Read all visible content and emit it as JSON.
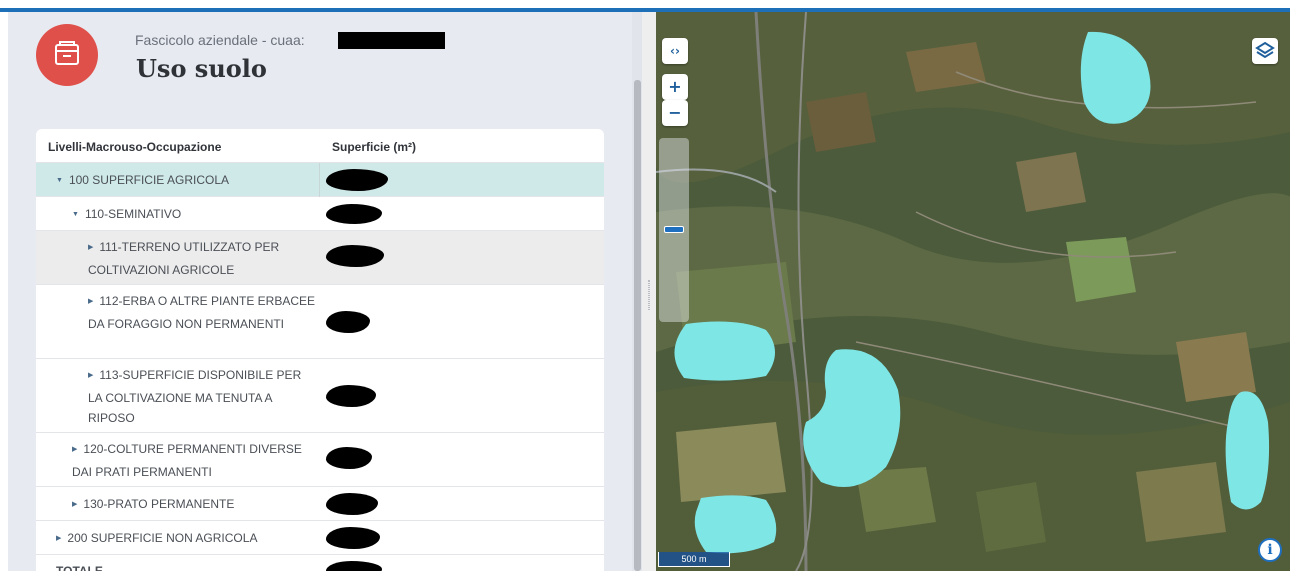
{
  "header": {
    "subtitle": "Fascicolo aziendale - cuaa:",
    "title": "Uso suolo"
  },
  "table": {
    "col_label": "Livelli-Macrouso-Occupazione",
    "col_area": "Superficie (m²)",
    "rows": [
      {
        "label": "100 SUPERFICIE AGRICOLA",
        "expanded": true
      },
      {
        "label": "110-SEMINATIVO",
        "expanded": true
      },
      {
        "label": "111-TERRENO UTILIZZATO PER COLTIVAZIONI AGRICOLE",
        "expanded": false
      },
      {
        "label": "112-ERBA O ALTRE PIANTE ERBACEE DA FORAGGIO NON PERMANENTI",
        "expanded": false
      },
      {
        "label": "113-SUPERFICIE DISPONIBILE PER LA COLTIVAZIONE MA TENUTA A RIPOSO",
        "expanded": false
      },
      {
        "label": "120-COLTURE PERMANENTI DIVERSE DAI PRATI PERMANENTI",
        "expanded": false
      },
      {
        "label": "130-PRATO PERMANENTE",
        "expanded": false
      },
      {
        "label": "200 SUPERFICIE NON AGRICOLA",
        "expanded": false
      },
      {
        "label": "TOTALE",
        "expanded": null
      }
    ]
  },
  "map": {
    "toggle_label": "‹›",
    "zoom_in": "+",
    "zoom_out": "−",
    "scale_label": "500 m",
    "info_label": "i",
    "layers_icon": "layers-icon",
    "parcel_color": "#7fe6e6"
  },
  "colors": {
    "accent": "#e0504b",
    "topbar": "#1d6fb8",
    "selected_row": "#cfe9e9"
  }
}
